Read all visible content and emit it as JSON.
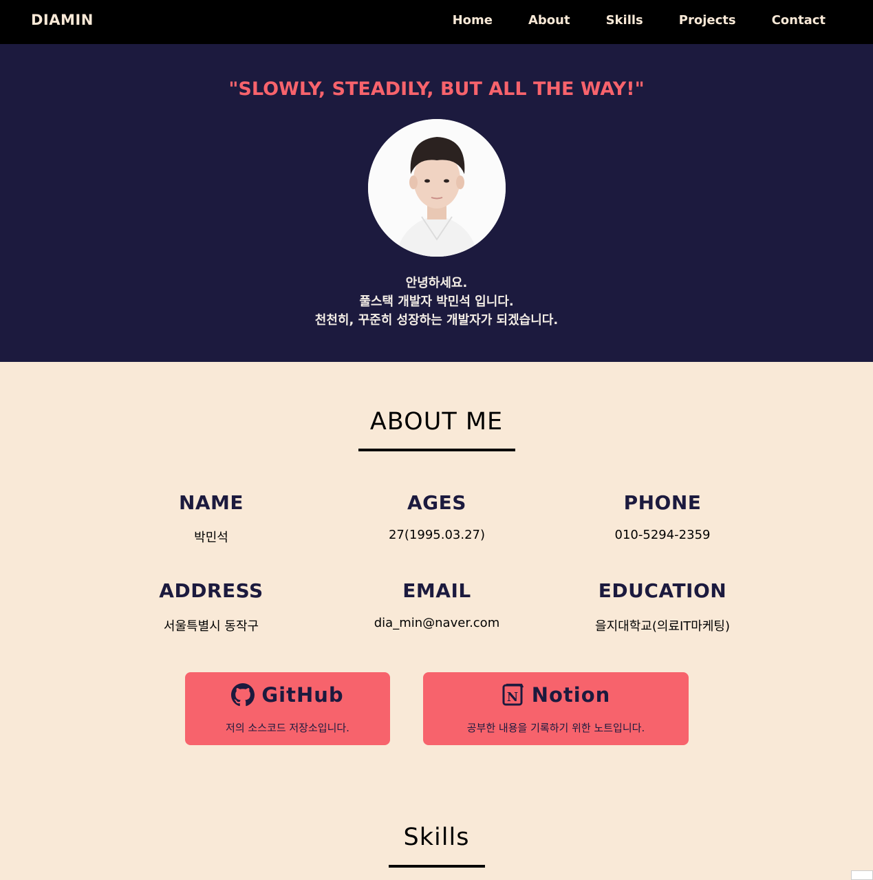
{
  "nav": {
    "logo": "DIAMIN",
    "links": [
      "Home",
      "About",
      "Skills",
      "Projects",
      "Contact"
    ]
  },
  "hero": {
    "motto": "\"SLOWLY, STEADILY, BUT ALL THE WAY!\"",
    "intro_lines": [
      "안녕하세요.",
      "풀스택 개발자 박민석 입니다.",
      "천천히, 꾸준히 성장하는 개발자가 되겠습니다."
    ]
  },
  "about": {
    "title": "ABOUT ME",
    "items": [
      {
        "label": "NAME",
        "value": "박민석"
      },
      {
        "label": "AGES",
        "value": "27(1995.03.27)"
      },
      {
        "label": "PHONE",
        "value": "010-5294-2359"
      },
      {
        "label": "ADDRESS",
        "value": "서울특별시 동작구"
      },
      {
        "label": "EMAIL",
        "value": "dia_min@naver.com"
      },
      {
        "label": "EDUCATION",
        "value": "을지대학교(의료IT마케팅)"
      }
    ],
    "cards": [
      {
        "title": "GitHub",
        "desc": "저의 소스코드 저장소입니다.",
        "icon": "github-icon"
      },
      {
        "title": "Notion",
        "desc": "공부한 내용을 기록하기 위한 노트입니다.",
        "icon": "notion-icon"
      }
    ]
  },
  "skills": {
    "title": "Skills"
  },
  "colors": {
    "navy": "#1c1a3e",
    "coral": "#f7636c",
    "cream": "#f9e9d7"
  }
}
